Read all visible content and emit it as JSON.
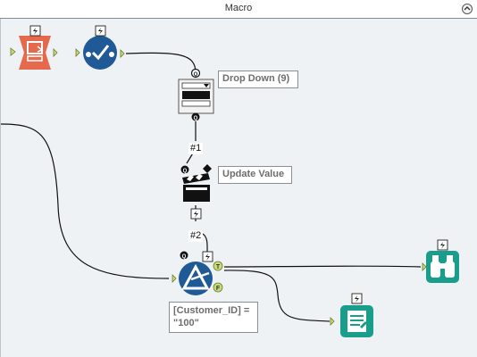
{
  "window": {
    "title": "Macro"
  },
  "annotations": {
    "drop_down": "Drop Down (9)",
    "update_value": "Update Value",
    "condition": "[Customer_ID] =\n\"100\""
  },
  "connection_labels": {
    "first": "#1",
    "second": "#2"
  },
  "anchor_labels": {
    "question": "Q",
    "true": "T",
    "false": "F"
  },
  "icons": {
    "macro_input": "macro-input-icon",
    "check": "check-tool-icon",
    "drop_down": "drop-down-icon",
    "action": "clapperboard-icon",
    "condition": "condition-tool-icon",
    "browse": "binoculars-icon",
    "output": "report-output-icon",
    "lightning": "lightning-icon"
  },
  "colors": {
    "canvas": "#eef2f5",
    "orange_tool": "#e5694d",
    "blue_tool": "#1f5a96",
    "teal_tool": "#1a9e8c",
    "anchor_green": "#c9dc7a"
  }
}
